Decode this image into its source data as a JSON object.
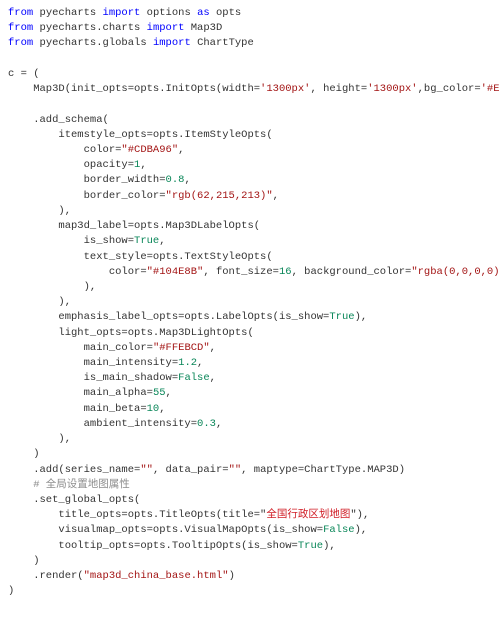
{
  "code_tokens": [
    [
      [
        "kw",
        "from"
      ],
      [
        "tok",
        " pyecharts "
      ],
      [
        "kw",
        "import"
      ],
      [
        "tok",
        " options "
      ],
      [
        "kw",
        "as"
      ],
      [
        "tok",
        " opts"
      ]
    ],
    [
      [
        "kw",
        "from"
      ],
      [
        "tok",
        " pyecharts.charts "
      ],
      [
        "kw",
        "import"
      ],
      [
        "tok",
        " Map3D"
      ]
    ],
    [
      [
        "kw",
        "from"
      ],
      [
        "tok",
        " pyecharts.globals "
      ],
      [
        "kw",
        "import"
      ],
      [
        "tok",
        " ChartType"
      ]
    ],
    [],
    [
      [
        "tok",
        "c = ("
      ]
    ],
    [
      [
        "tok",
        "    Map3D(init_opts=opts.InitOpts(width="
      ],
      [
        "str",
        "'1300px'"
      ],
      [
        "tok",
        ", height="
      ],
      [
        "str",
        "'1300px'"
      ],
      [
        "tok",
        ",bg_color="
      ],
      [
        "str",
        "'#EBEBEB'"
      ],
      [
        "tok",
        "))"
      ]
    ],
    [],
    [
      [
        "tok",
        "    .add_schema("
      ]
    ],
    [
      [
        "tok",
        "        itemstyle_opts=opts.ItemStyleOpts("
      ]
    ],
    [
      [
        "tok",
        "            color="
      ],
      [
        "str",
        "\"#CDBA96\""
      ],
      [
        "tok",
        ","
      ]
    ],
    [
      [
        "tok",
        "            opacity="
      ],
      [
        "num",
        "1"
      ],
      [
        "tok",
        ","
      ]
    ],
    [
      [
        "tok",
        "            border_width="
      ],
      [
        "num",
        "0.8"
      ],
      [
        "tok",
        ","
      ]
    ],
    [
      [
        "tok",
        "            border_color="
      ],
      [
        "str",
        "\"rgb(62,215,213)\""
      ],
      [
        "tok",
        ","
      ]
    ],
    [
      [
        "tok",
        "        ),"
      ]
    ],
    [
      [
        "tok",
        "        map3d_label=opts.Map3DLabelOpts("
      ]
    ],
    [
      [
        "tok",
        "            is_show="
      ],
      [
        "num",
        "True"
      ],
      [
        "tok",
        ","
      ]
    ],
    [
      [
        "tok",
        "            text_style=opts.TextStyleOpts("
      ]
    ],
    [
      [
        "tok",
        "                color="
      ],
      [
        "str",
        "\"#104E8B\""
      ],
      [
        "tok",
        ", font_size="
      ],
      [
        "num",
        "16"
      ],
      [
        "tok",
        ", background_color="
      ],
      [
        "str",
        "\"rgba(0,0,0,0)\""
      ]
    ],
    [
      [
        "tok",
        "            ),"
      ]
    ],
    [
      [
        "tok",
        "        ),"
      ]
    ],
    [
      [
        "tok",
        "        emphasis_label_opts=opts.LabelOpts(is_show="
      ],
      [
        "num",
        "True"
      ],
      [
        "tok",
        "),"
      ]
    ],
    [
      [
        "tok",
        "        light_opts=opts.Map3DLightOpts("
      ]
    ],
    [
      [
        "tok",
        "            main_color="
      ],
      [
        "str",
        "\"#FFEBCD\""
      ],
      [
        "tok",
        ","
      ]
    ],
    [
      [
        "tok",
        "            main_intensity="
      ],
      [
        "num",
        "1.2"
      ],
      [
        "tok",
        ","
      ]
    ],
    [
      [
        "tok",
        "            is_main_shadow="
      ],
      [
        "num",
        "False"
      ],
      [
        "tok",
        ","
      ]
    ],
    [
      [
        "tok",
        "            main_alpha="
      ],
      [
        "num",
        "55"
      ],
      [
        "tok",
        ","
      ]
    ],
    [
      [
        "tok",
        "            main_beta="
      ],
      [
        "num",
        "10"
      ],
      [
        "tok",
        ","
      ]
    ],
    [
      [
        "tok",
        "            ambient_intensity="
      ],
      [
        "num",
        "0.3"
      ],
      [
        "tok",
        ","
      ]
    ],
    [
      [
        "tok",
        "        ),"
      ]
    ],
    [
      [
        "tok",
        "    )"
      ]
    ],
    [
      [
        "tok",
        "    .add(series_name="
      ],
      [
        "str",
        "\"\""
      ],
      [
        "tok",
        ", data_pair="
      ],
      [
        "str",
        "\"\""
      ],
      [
        "tok",
        ", maptype=ChartType.MAP3D)"
      ]
    ],
    [
      [
        "cmt",
        "    # 全局设置地图属性"
      ]
    ],
    [
      [
        "tok",
        "    .set_global_opts("
      ]
    ],
    [
      [
        "tok",
        "        title_opts=opts.TitleOpts(title=\""
      ],
      [
        "red",
        "全国行政区划地图"
      ],
      [
        "tok",
        "\"),"
      ]
    ],
    [
      [
        "tok",
        "        visualmap_opts=opts.VisualMapOpts(is_show="
      ],
      [
        "num",
        "False"
      ],
      [
        "tok",
        "),"
      ]
    ],
    [
      [
        "tok",
        "        tooltip_opts=opts.TooltipOpts(is_show="
      ],
      [
        "num",
        "True"
      ],
      [
        "tok",
        "),"
      ]
    ],
    [
      [
        "tok",
        "    )"
      ]
    ],
    [
      [
        "tok",
        "    .render("
      ],
      [
        "str",
        "\"map3d_china_base.html\""
      ],
      [
        "tok",
        ")"
      ]
    ],
    [
      [
        "tok",
        ")"
      ]
    ]
  ]
}
